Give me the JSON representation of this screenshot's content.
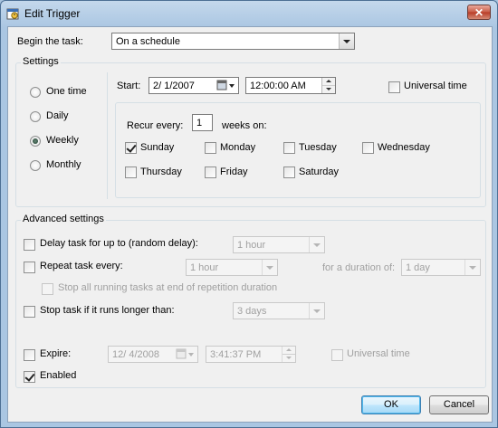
{
  "window": {
    "title": "Edit Trigger",
    "close_glyph": "✕"
  },
  "begin": {
    "label": "Begin the task:",
    "value": "On a schedule"
  },
  "settings": {
    "group_title": "Settings",
    "radios": [
      {
        "label": "One time",
        "selected": false
      },
      {
        "label": "Daily",
        "selected": false
      },
      {
        "label": "Weekly",
        "selected": true
      },
      {
        "label": "Monthly",
        "selected": false
      }
    ],
    "start_label": "Start:",
    "start_date": "2/ 1/2007",
    "start_time": "12:00:00 AM",
    "universal_time": {
      "label": "Universal time",
      "checked": false
    },
    "recur_label": "Recur every:",
    "recur_value": "1",
    "weeks_on_label": "weeks on:",
    "days": [
      {
        "label": "Sunday",
        "checked": true
      },
      {
        "label": "Monday",
        "checked": false
      },
      {
        "label": "Tuesday",
        "checked": false
      },
      {
        "label": "Wednesday",
        "checked": false
      },
      {
        "label": "Thursday",
        "checked": false
      },
      {
        "label": "Friday",
        "checked": false
      },
      {
        "label": "Saturday",
        "checked": false
      }
    ]
  },
  "advanced": {
    "group_title": "Advanced settings",
    "delay": {
      "label": "Delay task for up to (random delay):",
      "checked": false,
      "value": "1 hour"
    },
    "repeat": {
      "label": "Repeat task every:",
      "checked": false,
      "value": "1 hour",
      "duration_label": "for a duration of:",
      "duration_value": "1 day"
    },
    "stop_running": {
      "label": "Stop all running tasks at end of repetition duration",
      "checked": false
    },
    "stop_longer": {
      "label": "Stop task if it runs longer than:",
      "checked": false,
      "value": "3 days"
    },
    "expire": {
      "label": "Expire:",
      "checked": false,
      "date": "12/ 4/2008",
      "time": "3:41:37 PM",
      "universal_label": "Universal time",
      "universal_checked": false
    },
    "enabled": {
      "label": "Enabled",
      "checked": true
    }
  },
  "buttons": {
    "ok": "OK",
    "cancel": "Cancel"
  }
}
